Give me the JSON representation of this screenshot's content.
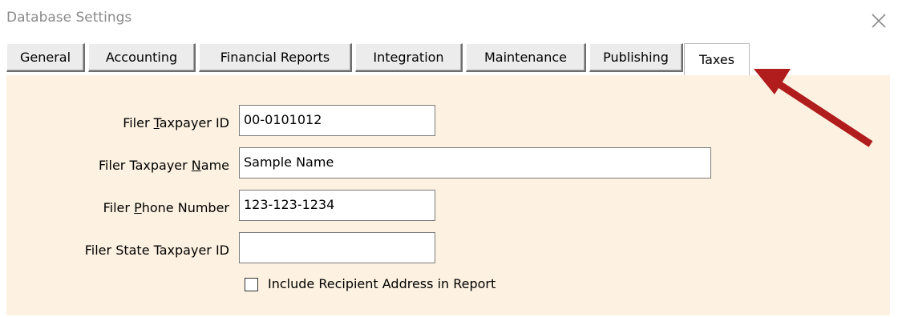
{
  "window": {
    "title": "Database Settings",
    "close_icon": "close-icon"
  },
  "tabs": [
    {
      "label": "General"
    },
    {
      "label": "Accounting"
    },
    {
      "label": "Financial Reports"
    },
    {
      "label": "Integration"
    },
    {
      "label": "Maintenance"
    },
    {
      "label": "Publishing"
    },
    {
      "label": "Taxes",
      "selected": true
    }
  ],
  "form": {
    "taxpayer_id": {
      "label_pre": "Filer ",
      "label_key": "T",
      "label_post": "axpayer ID",
      "value": "00-0101012"
    },
    "taxpayer_name": {
      "label_pre": "Filer Taxpayer ",
      "label_key": "N",
      "label_post": "ame",
      "value": "Sample Name"
    },
    "phone": {
      "label_pre": "Filer ",
      "label_key": "P",
      "label_post": "hone Number",
      "value": "123-123-1234"
    },
    "state_taxpayer_id": {
      "label": "Filer State Taxpayer ID",
      "value": ""
    },
    "include_address": {
      "label": "Include Recipient Address in Report",
      "checked": false
    }
  },
  "colors": {
    "panel_background": "#fdf2e1",
    "arrow": "#b11d1d"
  },
  "annotation_icon": "red-arrow-icon"
}
